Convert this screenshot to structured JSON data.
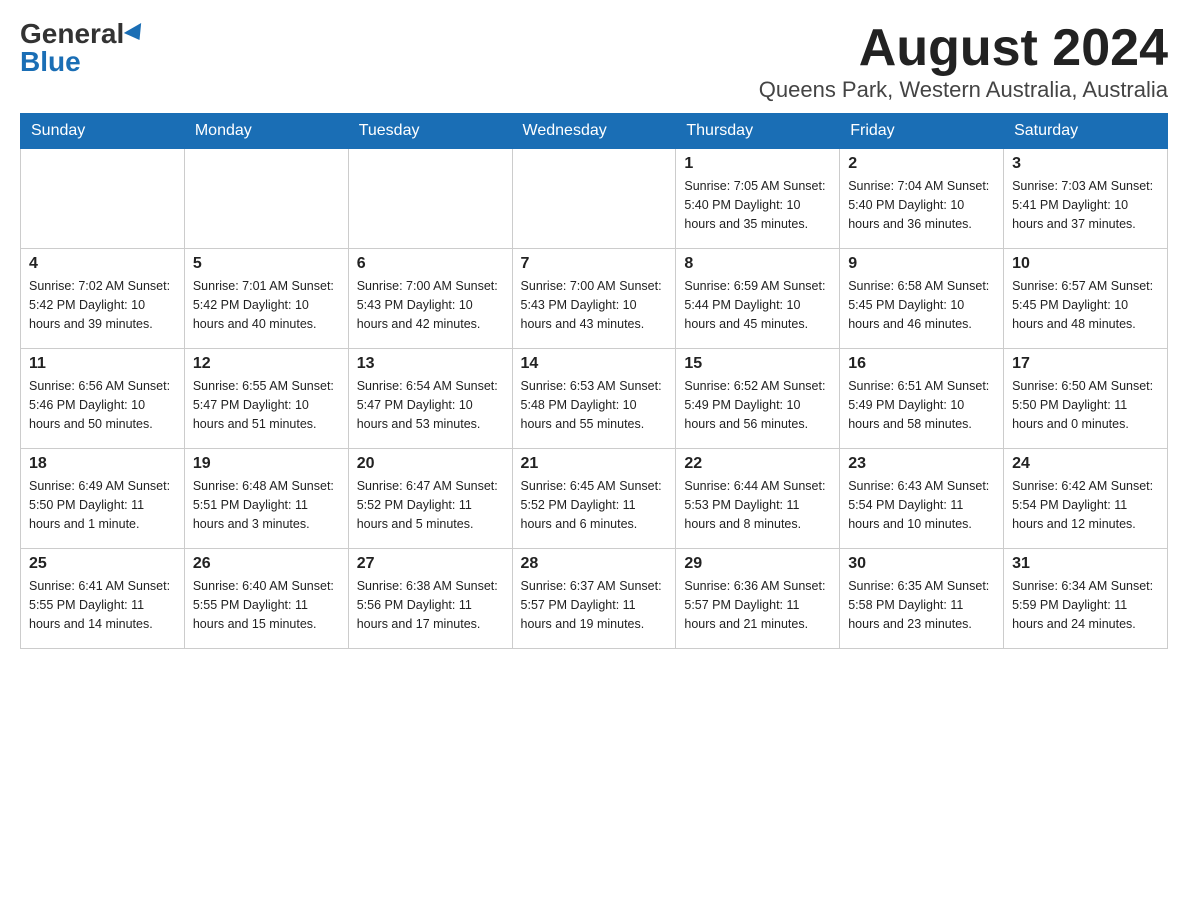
{
  "header": {
    "logo_general": "General",
    "logo_blue": "Blue",
    "month_year": "August 2024",
    "location": "Queens Park, Western Australia, Australia"
  },
  "days_of_week": [
    "Sunday",
    "Monday",
    "Tuesday",
    "Wednesday",
    "Thursday",
    "Friday",
    "Saturday"
  ],
  "weeks": [
    [
      {
        "day": "",
        "info": ""
      },
      {
        "day": "",
        "info": ""
      },
      {
        "day": "",
        "info": ""
      },
      {
        "day": "",
        "info": ""
      },
      {
        "day": "1",
        "info": "Sunrise: 7:05 AM\nSunset: 5:40 PM\nDaylight: 10 hours and 35 minutes."
      },
      {
        "day": "2",
        "info": "Sunrise: 7:04 AM\nSunset: 5:40 PM\nDaylight: 10 hours and 36 minutes."
      },
      {
        "day": "3",
        "info": "Sunrise: 7:03 AM\nSunset: 5:41 PM\nDaylight: 10 hours and 37 minutes."
      }
    ],
    [
      {
        "day": "4",
        "info": "Sunrise: 7:02 AM\nSunset: 5:42 PM\nDaylight: 10 hours and 39 minutes."
      },
      {
        "day": "5",
        "info": "Sunrise: 7:01 AM\nSunset: 5:42 PM\nDaylight: 10 hours and 40 minutes."
      },
      {
        "day": "6",
        "info": "Sunrise: 7:00 AM\nSunset: 5:43 PM\nDaylight: 10 hours and 42 minutes."
      },
      {
        "day": "7",
        "info": "Sunrise: 7:00 AM\nSunset: 5:43 PM\nDaylight: 10 hours and 43 minutes."
      },
      {
        "day": "8",
        "info": "Sunrise: 6:59 AM\nSunset: 5:44 PM\nDaylight: 10 hours and 45 minutes."
      },
      {
        "day": "9",
        "info": "Sunrise: 6:58 AM\nSunset: 5:45 PM\nDaylight: 10 hours and 46 minutes."
      },
      {
        "day": "10",
        "info": "Sunrise: 6:57 AM\nSunset: 5:45 PM\nDaylight: 10 hours and 48 minutes."
      }
    ],
    [
      {
        "day": "11",
        "info": "Sunrise: 6:56 AM\nSunset: 5:46 PM\nDaylight: 10 hours and 50 minutes."
      },
      {
        "day": "12",
        "info": "Sunrise: 6:55 AM\nSunset: 5:47 PM\nDaylight: 10 hours and 51 minutes."
      },
      {
        "day": "13",
        "info": "Sunrise: 6:54 AM\nSunset: 5:47 PM\nDaylight: 10 hours and 53 minutes."
      },
      {
        "day": "14",
        "info": "Sunrise: 6:53 AM\nSunset: 5:48 PM\nDaylight: 10 hours and 55 minutes."
      },
      {
        "day": "15",
        "info": "Sunrise: 6:52 AM\nSunset: 5:49 PM\nDaylight: 10 hours and 56 minutes."
      },
      {
        "day": "16",
        "info": "Sunrise: 6:51 AM\nSunset: 5:49 PM\nDaylight: 10 hours and 58 minutes."
      },
      {
        "day": "17",
        "info": "Sunrise: 6:50 AM\nSunset: 5:50 PM\nDaylight: 11 hours and 0 minutes."
      }
    ],
    [
      {
        "day": "18",
        "info": "Sunrise: 6:49 AM\nSunset: 5:50 PM\nDaylight: 11 hours and 1 minute."
      },
      {
        "day": "19",
        "info": "Sunrise: 6:48 AM\nSunset: 5:51 PM\nDaylight: 11 hours and 3 minutes."
      },
      {
        "day": "20",
        "info": "Sunrise: 6:47 AM\nSunset: 5:52 PM\nDaylight: 11 hours and 5 minutes."
      },
      {
        "day": "21",
        "info": "Sunrise: 6:45 AM\nSunset: 5:52 PM\nDaylight: 11 hours and 6 minutes."
      },
      {
        "day": "22",
        "info": "Sunrise: 6:44 AM\nSunset: 5:53 PM\nDaylight: 11 hours and 8 minutes."
      },
      {
        "day": "23",
        "info": "Sunrise: 6:43 AM\nSunset: 5:54 PM\nDaylight: 11 hours and 10 minutes."
      },
      {
        "day": "24",
        "info": "Sunrise: 6:42 AM\nSunset: 5:54 PM\nDaylight: 11 hours and 12 minutes."
      }
    ],
    [
      {
        "day": "25",
        "info": "Sunrise: 6:41 AM\nSunset: 5:55 PM\nDaylight: 11 hours and 14 minutes."
      },
      {
        "day": "26",
        "info": "Sunrise: 6:40 AM\nSunset: 5:55 PM\nDaylight: 11 hours and 15 minutes."
      },
      {
        "day": "27",
        "info": "Sunrise: 6:38 AM\nSunset: 5:56 PM\nDaylight: 11 hours and 17 minutes."
      },
      {
        "day": "28",
        "info": "Sunrise: 6:37 AM\nSunset: 5:57 PM\nDaylight: 11 hours and 19 minutes."
      },
      {
        "day": "29",
        "info": "Sunrise: 6:36 AM\nSunset: 5:57 PM\nDaylight: 11 hours and 21 minutes."
      },
      {
        "day": "30",
        "info": "Sunrise: 6:35 AM\nSunset: 5:58 PM\nDaylight: 11 hours and 23 minutes."
      },
      {
        "day": "31",
        "info": "Sunrise: 6:34 AM\nSunset: 5:59 PM\nDaylight: 11 hours and 24 minutes."
      }
    ]
  ]
}
